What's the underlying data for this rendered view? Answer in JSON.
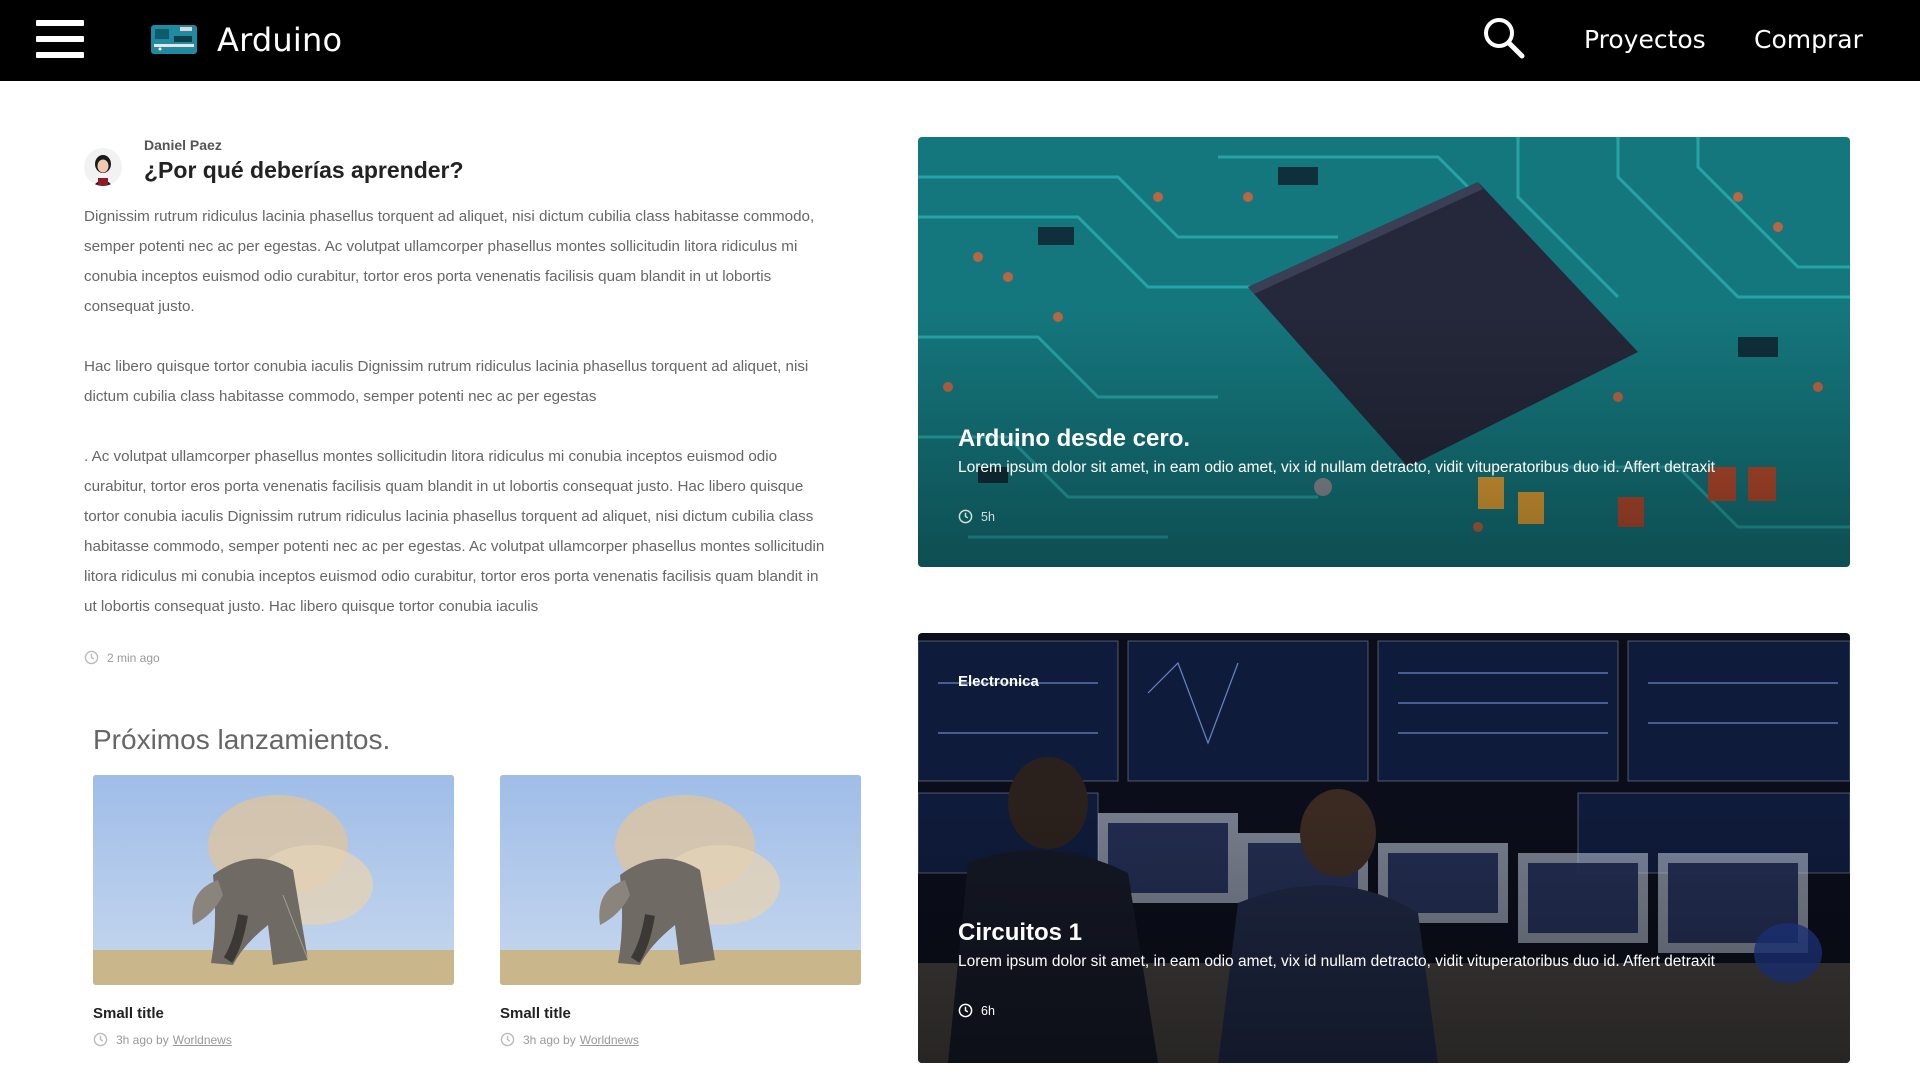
{
  "header": {
    "brand": "Arduino",
    "nav": {
      "proyectos": "Proyectos",
      "comprar": "Comprar"
    }
  },
  "article": {
    "author": "Daniel Paez",
    "title": "¿Por qué deberías aprender?",
    "paragraphs": [
      "Dignissim rutrum ridiculus lacinia phasellus torquent ad aliquet, nisi dictum cubilia class habitasse commodo, semper potenti nec ac per egestas. Ac volutpat ullamcorper phasellus montes sollicitudin litora ridiculus mi conubia inceptos euismod odio curabitur, tortor eros porta venenatis facilisis quam blandit in ut lobortis consequat justo.",
      " Hac libero quisque tortor conubia iaculis Dignissim rutrum ridiculus lacinia phasellus torquent ad aliquet, nisi dictum cubilia class habitasse commodo, semper potenti nec ac per egestas",
      ". Ac volutpat ullamcorper phasellus montes sollicitudin litora ridiculus mi conubia inceptos euismod odio curabitur, tortor eros porta venenatis facilisis quam blandit in ut lobortis consequat justo. Hac libero quisque tortor conubia iaculis Dignissim rutrum ridiculus lacinia phasellus torquent ad aliquet, nisi dictum cubilia class habitasse commodo, semper potenti nec ac per egestas. Ac volutpat ullamcorper phasellus montes sollicitudin litora ridiculus mi conubia inceptos euismod odio curabitur, tortor eros porta venenatis facilisis quam blandit in ut lobortis consequat justo. Hac libero quisque tortor conubia iaculis"
    ],
    "time": "2 min ago"
  },
  "upcoming": {
    "title": "Próximos lanzamientos.",
    "cards": [
      {
        "title": "Small title",
        "meta_prefix": "3h ago by",
        "source": "Worldnews"
      },
      {
        "title": "Small title",
        "meta_prefix": "3h ago by",
        "source": "Worldnews"
      }
    ]
  },
  "featured": [
    {
      "title": "Arduino desde cero.",
      "description": "Lorem ipsum dolor sit amet, in eam odio amet, vix id nullam detracto, vidit vituperatoribus duo id. Affert detraxit",
      "time": "5h"
    },
    {
      "category": "Electronica",
      "title": "Circuitos 1",
      "description": "Lorem ipsum dolor sit amet, in eam odio amet, vix id nullam detracto, vidit vituperatoribus duo id. Affert detraxit",
      "time": "6h"
    }
  ],
  "colors": {
    "header_bg": "#000000",
    "text_muted": "#666666",
    "pcb_teal": "#1d8f95",
    "chip_dark": "#24283a"
  }
}
